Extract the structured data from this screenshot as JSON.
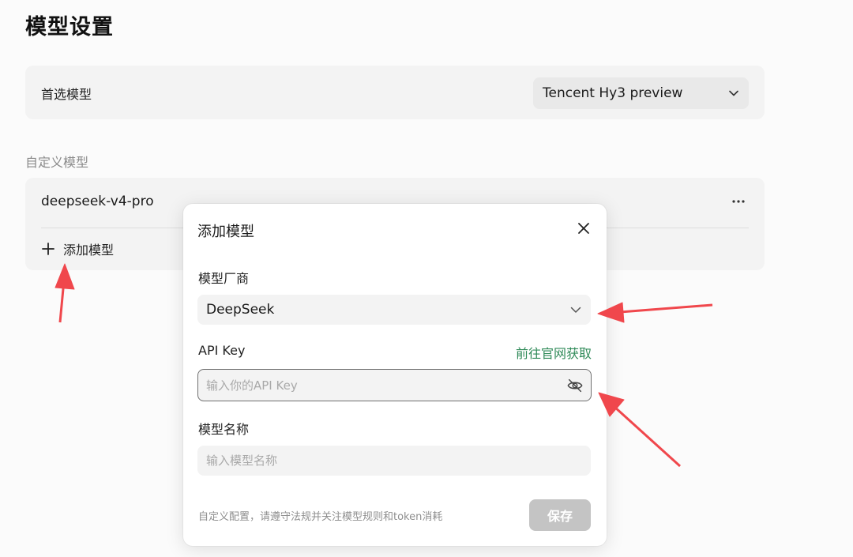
{
  "page": {
    "title": "模型设置"
  },
  "preferred": {
    "label": "首选模型",
    "selected": "Tencent Hy3 preview",
    "dropdown_icon": "chevron-down-icon"
  },
  "custom_models": {
    "section_label": "自定义模型",
    "items": [
      {
        "name": "deepseek-v4-pro",
        "menu_icon": "more-horizontal-icon"
      }
    ],
    "add_label": "添加模型",
    "add_icon": "plus-icon"
  },
  "dialog": {
    "title": "添加模型",
    "close_icon": "close-icon",
    "vendor": {
      "label": "模型厂商",
      "selected": "DeepSeek"
    },
    "api_key": {
      "label": "API Key",
      "link_label": "前往官网获取",
      "placeholder": "输入你的API Key",
      "value": "",
      "visibility_icon": "eye-off-icon"
    },
    "model_name": {
      "label": "模型名称",
      "placeholder": "输入模型名称",
      "value": ""
    },
    "footer_note": "自定义配置，请遵守法规并关注模型规则和token消耗",
    "save_label": "保存"
  },
  "colors": {
    "page_background": "#fbfbfb",
    "card_background": "#f3f3f3",
    "link": "#2f8a58",
    "save_disabled": "#c4c4c4",
    "annotation_arrow": "#f0474c"
  }
}
